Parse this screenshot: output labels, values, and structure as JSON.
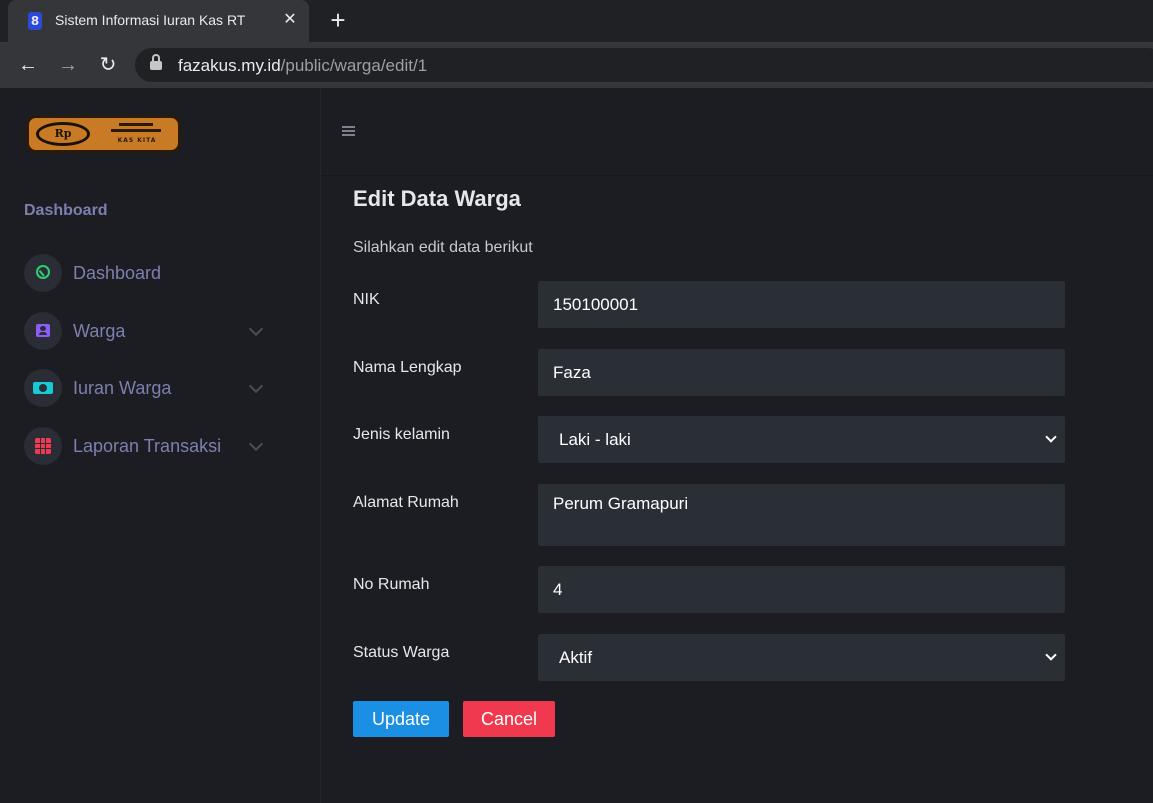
{
  "browser": {
    "tab_title": "Sistem Informasi Iuran Kas RT",
    "tab_favicon": "8",
    "close_glyph": "✕",
    "new_tab_glyph": "+",
    "back_glyph": "←",
    "forward_glyph": "→",
    "reload_glyph": "↻",
    "url_host": "fazakus.my.id",
    "url_path": "/public/warga/edit/1"
  },
  "logo": {
    "coin_text": "Rp",
    "brand_text": "KAS KITA"
  },
  "sidebar": {
    "section_title": "Dashboard",
    "items": [
      {
        "label": "Dashboard",
        "icon": "gauge-icon",
        "color": "#2dcf72",
        "has_chevron": false
      },
      {
        "label": "Warga",
        "icon": "person-card-icon",
        "color": "#8b5cf6",
        "has_chevron": true
      },
      {
        "label": "Iuran Warga",
        "icon": "money-icon",
        "color": "#18c9d6",
        "has_chevron": true
      },
      {
        "label": "Laporan Transaksi",
        "icon": "table-icon",
        "color": "#ee3a50",
        "has_chevron": true
      }
    ]
  },
  "form": {
    "title": "Edit Data Warga",
    "subtitle": "Silahkan edit data berikut",
    "fields": {
      "nik": {
        "label": "NIK",
        "value": "150100001"
      },
      "nama": {
        "label": "Nama Lengkap",
        "value": "Faza"
      },
      "jenis_kelamin": {
        "label": "Jenis kelamin",
        "value": "Laki - laki"
      },
      "alamat": {
        "label": "Alamat Rumah",
        "value": "Perum Gramapuri"
      },
      "no_rumah": {
        "label": "No Rumah",
        "value": "4"
      },
      "status": {
        "label": "Status Warga",
        "value": "Aktif"
      }
    },
    "update_label": "Update",
    "cancel_label": "Cancel"
  },
  "colors": {
    "accent_update": "#1a8fe3",
    "accent_cancel": "#f0384f",
    "background": "#1b1d23",
    "field_background": "#2a2f36"
  }
}
